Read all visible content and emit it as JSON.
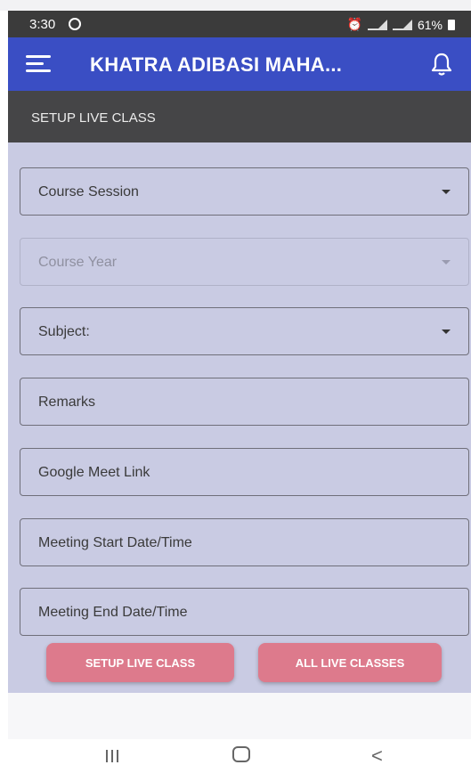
{
  "status_bar": {
    "time": "3:30",
    "battery": "61%"
  },
  "app_bar": {
    "title": "KHATRA ADIBASI MAHA..."
  },
  "section": {
    "title": "SETUP LIVE CLASS"
  },
  "form": {
    "course_session": "Course Session",
    "course_year": "Course Year",
    "subject": "Subject:",
    "remarks": "Remarks",
    "meet_link": "Google Meet Link",
    "start_time": "Meeting Start Date/Time",
    "end_time": "Meeting End Date/Time"
  },
  "buttons": {
    "setup": "SETUP LIVE CLASS",
    "all": "ALL LIVE CLASSES"
  },
  "colors": {
    "app_bar": "#3a4ec4",
    "content": "#c9cbe3",
    "button": "#dd7a8c",
    "header": "#454547"
  },
  "icons": [
    "whatsapp-icon",
    "alarm-icon",
    "wifi-icon",
    "signal-icon",
    "battery-icon",
    "menu-icon",
    "bell-icon",
    "caret-down-icon",
    "nav-recents-icon",
    "nav-home-icon",
    "nav-back-icon"
  ]
}
